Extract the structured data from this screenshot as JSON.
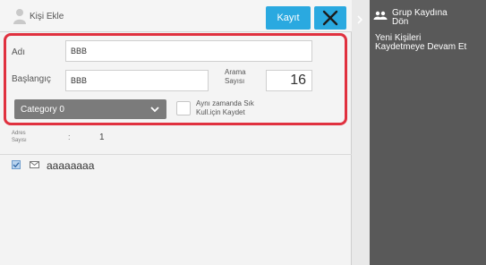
{
  "header": {
    "title": "Kişi Ekle",
    "save_label": "Kayıt"
  },
  "form": {
    "name_label": "Adı",
    "name_value": "BBB",
    "initial_label": "Başlangıç",
    "initial_value": "BBB",
    "search_count_label_line1": "Arama",
    "search_count_label_line2": "Sayısı",
    "search_count_value": "16",
    "category_selected": "Category 0",
    "frequent_label_line1": "Aynı zamanda Sık",
    "frequent_label_line2": "Kull.için Kaydet"
  },
  "address": {
    "label_line1": "Adres",
    "label_line2": "Sayısı",
    "separator": ":",
    "count": "1"
  },
  "list": [
    {
      "name": "aaaaaaaa"
    }
  ],
  "sidebar": {
    "back_label_line1": "Grup Kaydına",
    "back_label_line2": "Dön",
    "continue_line1": "Yeni Kişileri",
    "continue_line2": "Kaydetmeye Devam Et"
  },
  "colors": {
    "accent": "#2aa9e0",
    "highlight_border": "#e0313f",
    "sidebar_bg": "#595959",
    "dropdown_bg": "#7b7b7b"
  },
  "icons": {
    "title": "person-icon",
    "close": "close-icon",
    "dropdown": "chevron-down-icon",
    "sidebar_arrow": "chevron-right-icon",
    "group": "group-icon",
    "entry_check": "check-icon",
    "entry_mail": "mail-icon"
  }
}
